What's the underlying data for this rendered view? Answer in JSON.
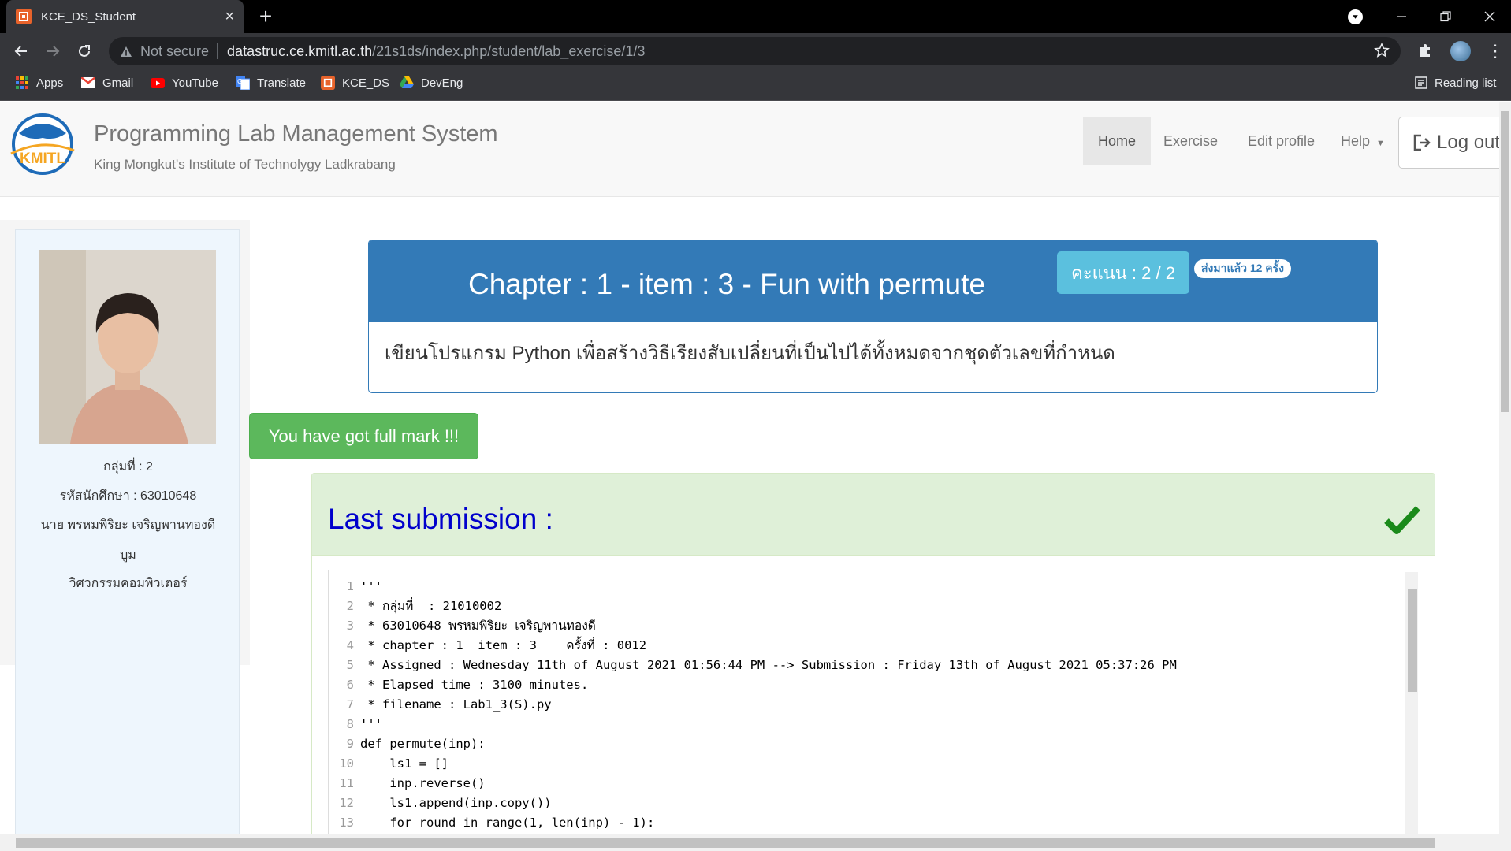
{
  "browser": {
    "tab_title": "KCE_DS_Student",
    "security_label": "Not secure",
    "url_host": "datastruc.ce.kmitl.ac.th",
    "url_path": "/21s1ds/index.php/student/lab_exercise/1/3",
    "bookmarks": [
      "Apps",
      "Gmail",
      "YouTube",
      "Translate",
      "KCE_DS",
      "DevEng"
    ],
    "reading_list": "Reading list"
  },
  "header": {
    "title": "Programming Lab Management System",
    "subtitle": "King Mongkut's Institute of Technolygy Ladkrabang",
    "logo_text": "KMITL",
    "nav": {
      "home": "Home",
      "exercise": "Exercise",
      "edit_profile": "Edit profile",
      "help": "Help",
      "logout": "Log out"
    }
  },
  "student": {
    "group": "กลุ่มที่ : 2",
    "student_id": "รหัสนักศึกษา : 63010648",
    "name": "นาย พรหมพิริยะ เจริญพานทองดี",
    "nickname": "บูม",
    "department": "วิศวกรรมคอมพิวเตอร์"
  },
  "exercise": {
    "title": "Chapter : 1 - item : 3 - Fun with permute",
    "score": "คะแนน : 2 / 2",
    "submissions": "ส่งมาแล้ว 12 ครั้ง",
    "description": "เขียนโปรแกรม Python เพื่อสร้างวิธีเรียงสับเปลี่ยนที่เป็นไปได้ทั้งหมดจากชุดตัวเลขที่กำหนด"
  },
  "full_mark_message": "You have got full mark !!!",
  "submission": {
    "title": "Last submission :",
    "code_lines": [
      {
        "n": "1",
        "text": "'''"
      },
      {
        "n": "2",
        "text": " * กลุ่มที่  : 21010002"
      },
      {
        "n": "3",
        "text": " * 63010648 พรหมพิริยะ เจริญพานทองดี"
      },
      {
        "n": "4",
        "text": " * chapter : 1  item : 3    ครั้งที่ : 0012"
      },
      {
        "n": "5",
        "text": " * Assigned : Wednesday 11th of August 2021 01:56:44 PM --> Submission : Friday 13th of August 2021 05:37:26 PM"
      },
      {
        "n": "6",
        "text": " * Elapsed time : 3100 minutes."
      },
      {
        "n": "7",
        "text": " * filename : Lab1_3(S).py"
      },
      {
        "n": "8",
        "text": "'''"
      },
      {
        "n": "9",
        "text": "def permute(inp):"
      },
      {
        "n": "10",
        "text": "    ls1 = []"
      },
      {
        "n": "11",
        "text": "    inp.reverse()"
      },
      {
        "n": "12",
        "text": "    ls1.append(inp.copy())"
      },
      {
        "n": "13",
        "text": "    for round in range(1, len(inp) - 1):"
      }
    ]
  },
  "colors": {
    "primary": "#337ab7",
    "info": "#5bc0de",
    "success": "#5cb85c",
    "success_bg": "#dff0d8",
    "submission_title": "#0000cc",
    "check": "#1a8a1a"
  }
}
